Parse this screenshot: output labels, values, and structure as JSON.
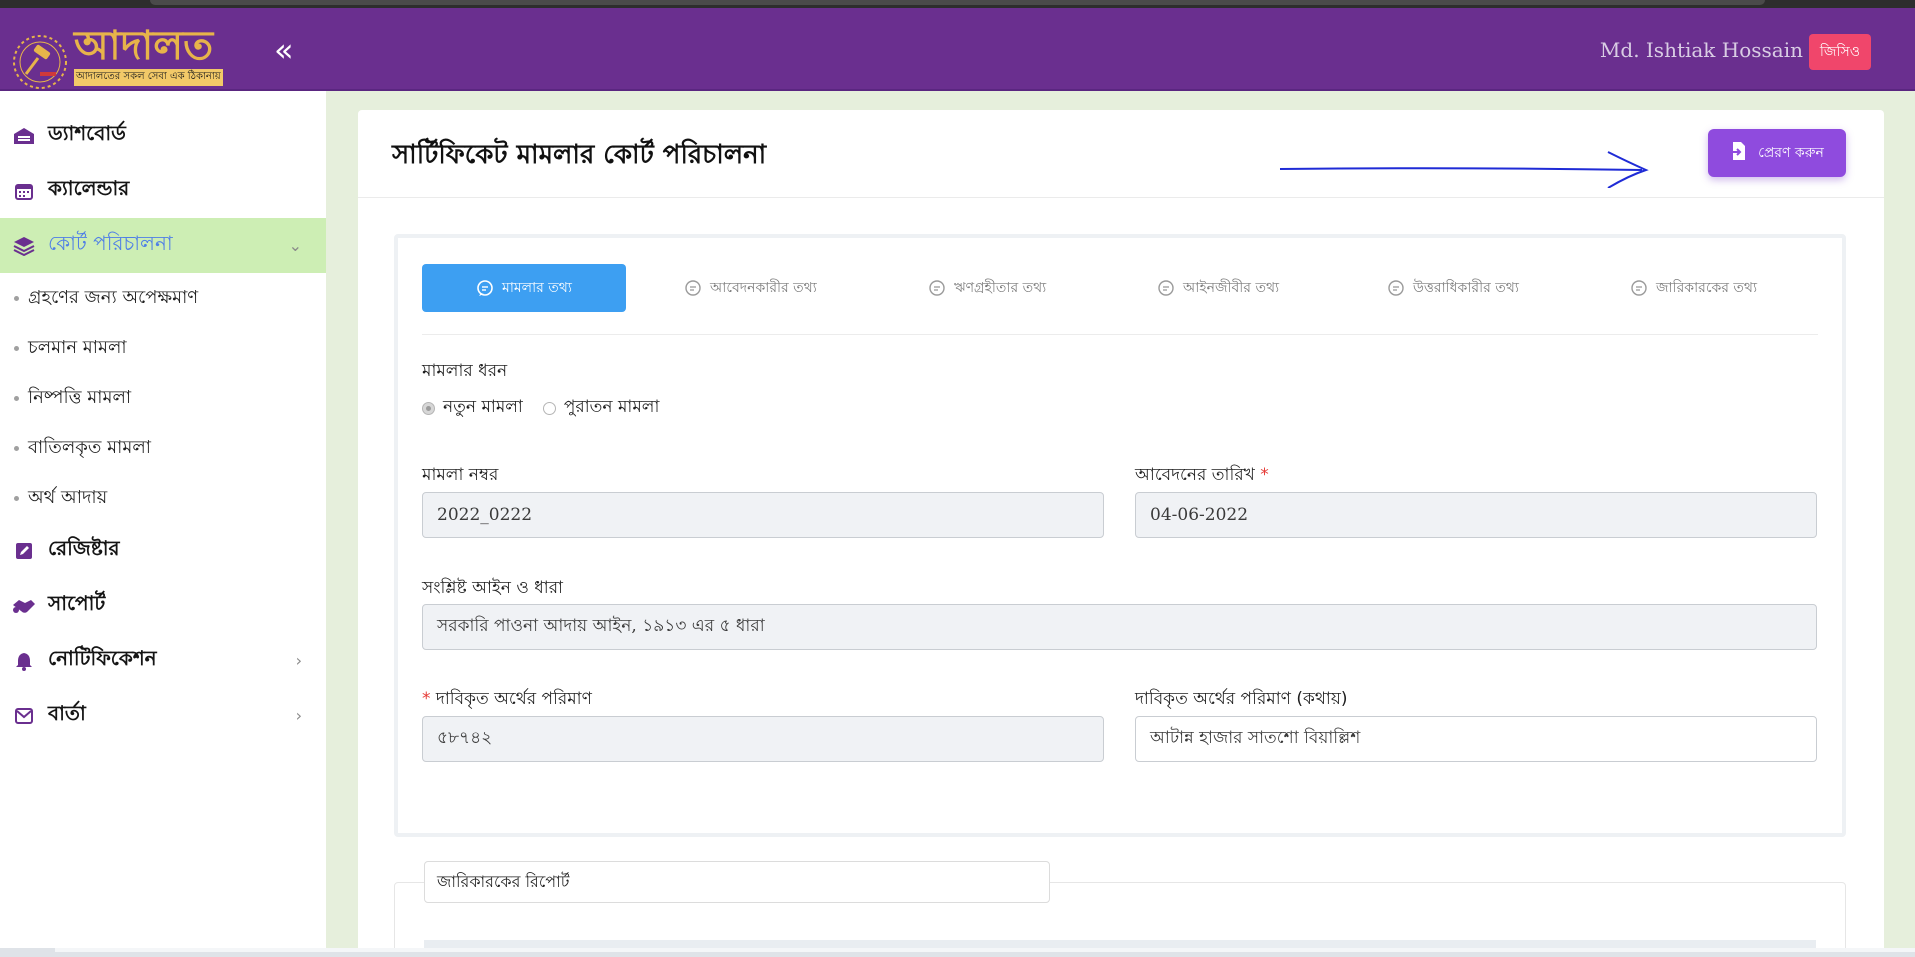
{
  "header": {
    "logo_title": "আদালত",
    "logo_tagline": "আদালতের সকল সেবা এক ঠিকানায়",
    "collapse_icon": "double-chevron-left-icon",
    "user_name": "Md. Ishtiak Hossain",
    "role_badge": "জিসিও",
    "colors": {
      "header_bg": "#6a2f8f",
      "logo_text": "#e7b44a",
      "badge": "#f0466b"
    }
  },
  "sidebar": {
    "items": [
      {
        "label": "ড্যাশবোর্ড",
        "icon": "dashboard-icon"
      },
      {
        "label": "ক্যালেন্ডার",
        "icon": "calendar-icon"
      },
      {
        "label": "কোর্ট পরিচালনা",
        "icon": "layers-icon",
        "active": true,
        "expanded": true
      },
      {
        "label": "রেজিষ্টার",
        "icon": "edit-icon"
      },
      {
        "label": "সাপোর্ট",
        "icon": "handshake-icon"
      },
      {
        "label": "নোটিফিকেশন",
        "icon": "bell-icon"
      },
      {
        "label": "বার্তা",
        "icon": "envelope-icon"
      }
    ],
    "subitems": [
      {
        "label": "গ্রহণের জন্য অপেক্ষমাণ"
      },
      {
        "label": "চলমান মামলা"
      },
      {
        "label": "নিষ্পত্তি মামলা"
      },
      {
        "label": "বাতিলকৃত মামলা"
      },
      {
        "label": "অর্থ আদায়"
      }
    ],
    "colors": {
      "active_bg": "#cdeeb4",
      "active_text": "#4f7fe6"
    }
  },
  "page": {
    "title": "সার্টিফিকেট মামলার কোর্ট পরিচালনা",
    "send_button": "প্রেরণ করুন",
    "send_icon": "file-export-icon",
    "colors": {
      "send_button": "#8f4bde",
      "active_tab": "#3d9ff2"
    }
  },
  "tabs": [
    {
      "label": "মামলার তথ্য",
      "active": true
    },
    {
      "label": "আবেদনকারীর তথ্য"
    },
    {
      "label": "ঋণগ্রহীতার তথ্য"
    },
    {
      "label": "আইনজীবীর তথ্য"
    },
    {
      "label": "উত্তরাধিকারীর তথ্য"
    },
    {
      "label": "জারিকারকের তথ্য"
    }
  ],
  "form": {
    "case_type_label": "মামলার ধরন",
    "case_type_options": [
      {
        "label": "নতুন মামলা",
        "selected": true
      },
      {
        "label": "পুরাতন মামলা",
        "selected": false
      }
    ],
    "case_no_label": "মামলা নম্বর",
    "case_no_value": "2022_0222",
    "app_date_label": "আবেদনের তারিখ",
    "app_date_required": "*",
    "app_date_value": "04-06-2022",
    "law_label": "সংশ্লিষ্ট আইন ও ধারা",
    "law_value": "সরকারি পাওনা আদায় আইন, ১৯১৩ এর ৫ ধারা",
    "amount_required": "*",
    "amount_label": "দাবিকৃত অর্থের পরিমাণ",
    "amount_value": "৫৮৭৪২",
    "amount_words_label": "দাবিকৃত অর্থের পরিমাণ (কথায়)",
    "amount_words_value": "আটান্ন হাজার সাতশো বিয়াল্লিশ"
  },
  "report": {
    "legend": "জারিকারকের রিপোর্ট"
  }
}
